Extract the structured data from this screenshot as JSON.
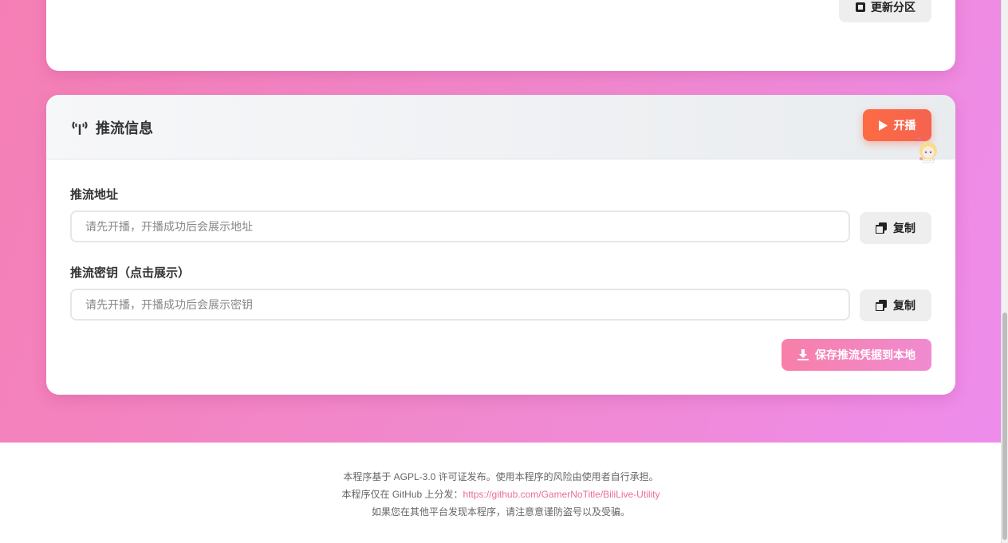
{
  "top_card": {
    "update_label": "更新分区"
  },
  "stream_card": {
    "title": "推流信息",
    "start_button": "开播",
    "address": {
      "label": "推流地址",
      "placeholder": "请先开播，开播成功后会展示地址",
      "copy_label": "复制"
    },
    "key": {
      "label": "推流密钥（点击展示）",
      "placeholder": "请先开播，开播成功后会展示密钥",
      "copy_label": "复制"
    },
    "save_button": "保存推流凭据到本地"
  },
  "footer": {
    "line1": "本程序基于 AGPL-3.0 许可证发布。使用本程序的风险由使用者自行承担。",
    "line2_prefix": "本程序仅在 GitHub 上分发：",
    "line2_link": "https://github.com/GamerNoTitle/BiliLive-Utility",
    "line3": "如果您在其他平台发现本程序，请注意意谨防盗号以及受骗。"
  },
  "colors": {
    "accent": "#f46350",
    "pink": "#f77fa8",
    "link": "#ec6b9a"
  },
  "icons": [
    "update-icon",
    "antenna-icon",
    "play-icon",
    "copy-icon",
    "download-icon",
    "mascot-icon"
  ]
}
